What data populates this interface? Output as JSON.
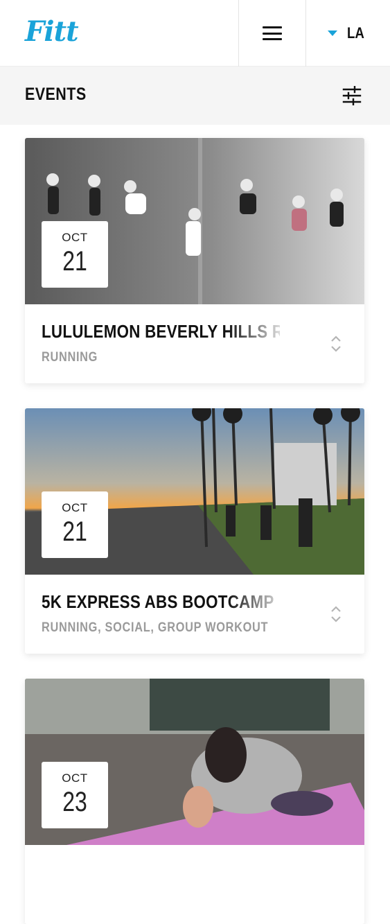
{
  "header": {
    "logo": "Fitt",
    "city": "LA"
  },
  "subbar": {
    "title": "EVENTS"
  },
  "events": [
    {
      "month": "OCT",
      "day": "21",
      "title": "LULULEMON BEVERLY HILLS RUN CLUB",
      "tags": "RUNNING",
      "photo": "runners-aerial-photo"
    },
    {
      "month": "OCT",
      "day": "21",
      "title": "5K EXPRESS ABS BOOTCAMP",
      "tags": "RUNNING, SOCIAL, GROUP WORKOUT",
      "photo": "beach-path-sunset-photo"
    },
    {
      "month": "OCT",
      "day": "23",
      "title": "",
      "tags": "",
      "photo": "yoga-rooftop-photo"
    }
  ],
  "colors": {
    "brand": "#1aa3d9",
    "subbar_bg": "#f5f5f5",
    "tag_gray": "#9a9a9a"
  }
}
